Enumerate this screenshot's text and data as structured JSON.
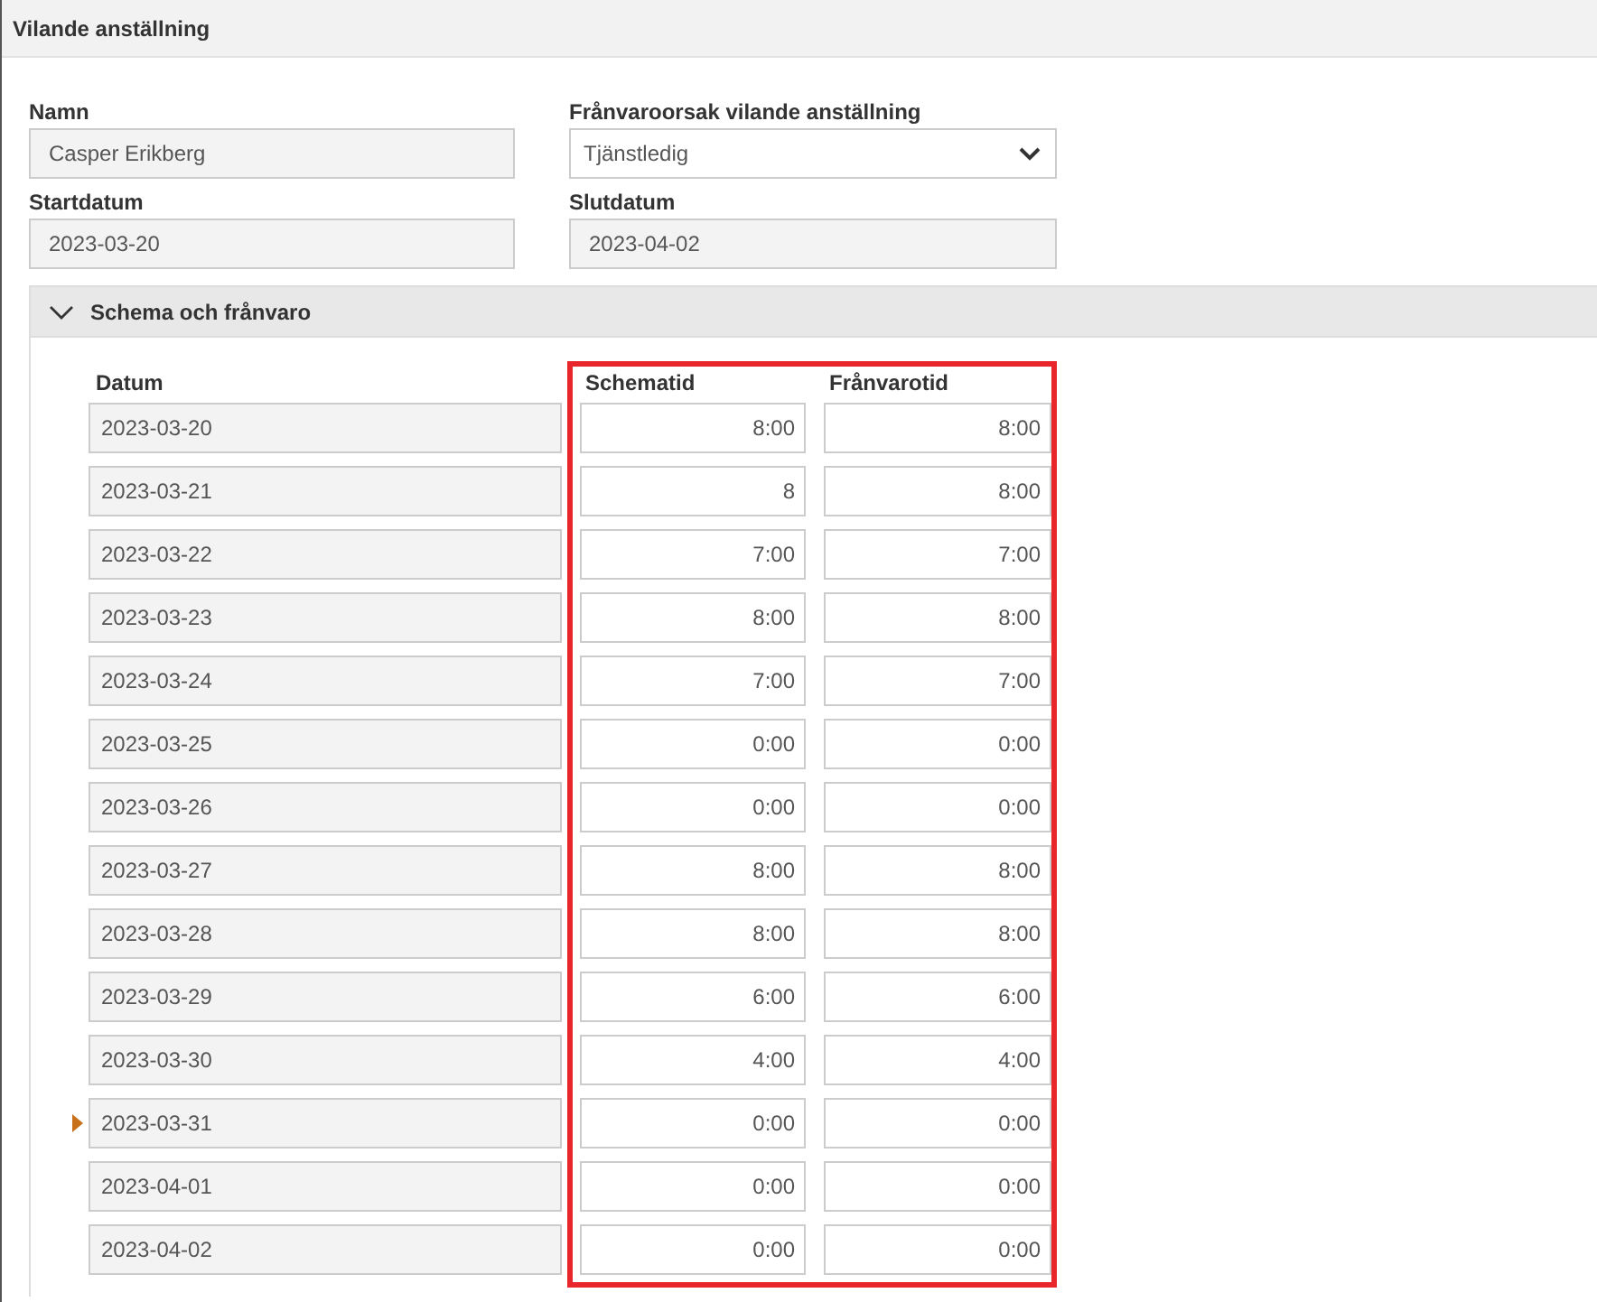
{
  "window": {
    "title": "Vilande anställning"
  },
  "form": {
    "name": {
      "label": "Namn",
      "value": "Casper Erikberg"
    },
    "reason": {
      "label": "Frånvaroorsak vilande anställning",
      "value": "Tjänstledig"
    },
    "start": {
      "label": "Startdatum",
      "value": "2023-03-20"
    },
    "end": {
      "label": "Slutdatum",
      "value": "2023-04-02"
    }
  },
  "section": {
    "title": "Schema och frånvaro",
    "expanded": true,
    "columns": [
      "Datum",
      "Schematid",
      "Frånvarotid"
    ],
    "rows": [
      {
        "date": "2023-03-20",
        "scheduled": "8:00",
        "absence": "8:00",
        "current": false
      },
      {
        "date": "2023-03-21",
        "scheduled": "8",
        "absence": "8:00",
        "current": false
      },
      {
        "date": "2023-03-22",
        "scheduled": "7:00",
        "absence": "7:00",
        "current": false
      },
      {
        "date": "2023-03-23",
        "scheduled": "8:00",
        "absence": "8:00",
        "current": false
      },
      {
        "date": "2023-03-24",
        "scheduled": "7:00",
        "absence": "7:00",
        "current": false
      },
      {
        "date": "2023-03-25",
        "scheduled": "0:00",
        "absence": "0:00",
        "current": false
      },
      {
        "date": "2023-03-26",
        "scheduled": "0:00",
        "absence": "0:00",
        "current": false
      },
      {
        "date": "2023-03-27",
        "scheduled": "8:00",
        "absence": "8:00",
        "current": false
      },
      {
        "date": "2023-03-28",
        "scheduled": "8:00",
        "absence": "8:00",
        "current": false
      },
      {
        "date": "2023-03-29",
        "scheduled": "6:00",
        "absence": "6:00",
        "current": false
      },
      {
        "date": "2023-03-30",
        "scheduled": "4:00",
        "absence": "4:00",
        "current": false
      },
      {
        "date": "2023-03-31",
        "scheduled": "0:00",
        "absence": "0:00",
        "current": true
      },
      {
        "date": "2023-04-01",
        "scheduled": "0:00",
        "absence": "0:00",
        "current": false
      },
      {
        "date": "2023-04-02",
        "scheduled": "0:00",
        "absence": "0:00",
        "current": false
      }
    ]
  }
}
